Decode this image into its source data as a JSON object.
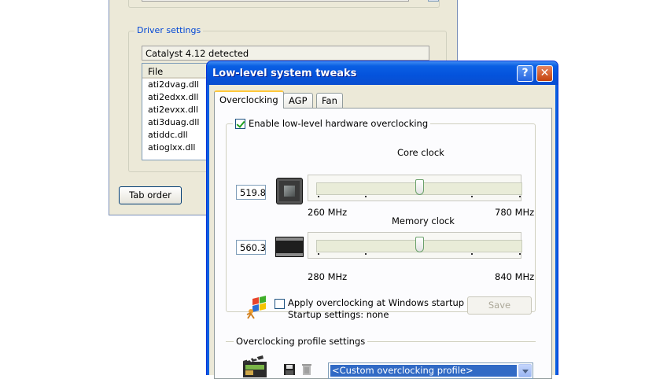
{
  "background_window": {
    "driver_group_label": "Driver settings",
    "detected_text": "Catalyst 4.12 detected",
    "file_column_header": "File",
    "files": [
      "ati2dvag.dll",
      "ati2edxx.dll",
      "ati2evxx.dll",
      "ati3duag.dll",
      "atiddc.dll",
      "atioglxx.dll"
    ],
    "tab_order_label": "Tab order"
  },
  "dialog": {
    "title": "Low-level system tweaks",
    "help_label": "?",
    "close_label": "✕",
    "tabs": [
      {
        "label": "Overclocking",
        "active": true
      },
      {
        "label": "AGP",
        "active": false
      },
      {
        "label": "Fan",
        "active": false
      }
    ],
    "enable_oc_label": "Enable low-level hardware overclocking",
    "enable_oc_checked": true,
    "core_clock": {
      "label": "Core clock",
      "value": "519.8",
      "min_label": "260 MHz",
      "max_label": "780 MHz",
      "position": 0.5
    },
    "memory_clock": {
      "label": "Memory clock",
      "value": "560.3",
      "min_label": "280 MHz",
      "max_label": "840 MHz",
      "position": 0.5
    },
    "startup": {
      "checkbox_label": "Apply overclocking at Windows startup",
      "settings_text": "Startup settings: none",
      "checked": false
    },
    "save_label": "Save",
    "profile_group_label": "Overclocking profile settings",
    "profile_selected": "<Custom overclocking profile>"
  },
  "colors": {
    "title_blue": "#0453dc",
    "legend_blue": "#0046d5",
    "selection_blue": "#316ac5",
    "tab_highlight": "#ffc83c"
  }
}
